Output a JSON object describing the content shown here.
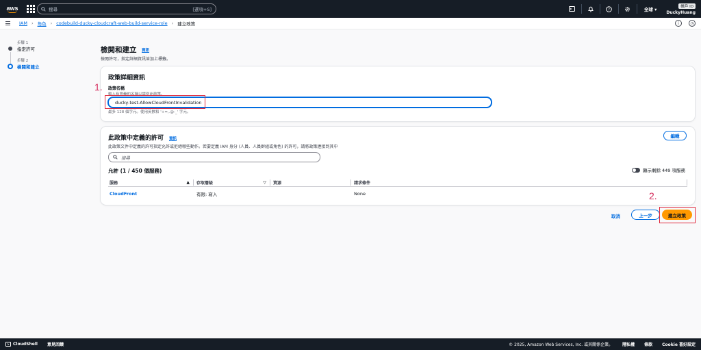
{
  "topnav": {
    "logo_text": "aws",
    "search_placeholder": "搜尋",
    "search_shortcut": "[選項+S]",
    "region": "全球",
    "account_id": "帳戶 ID",
    "username": "DuckyHuang"
  },
  "breadcrumb": {
    "items": [
      "IAM",
      "角色",
      "codebuild-ducky-cloudcraft-web-build-service-role"
    ],
    "current": "建立政策"
  },
  "steps": [
    {
      "number": "步驟 1",
      "label": "指定許可"
    },
    {
      "number": "步驟 2",
      "label": "檢閱和建立"
    }
  ],
  "page": {
    "title": "檢閱和建立",
    "info": "資訊",
    "description": "檢閱許可，指定詳細資訊並加上標籤。"
  },
  "policy_details": {
    "title": "政策詳細資訊",
    "name_label": "政策名稱",
    "name_description": "輸入有意義的名稱以識別此政策。",
    "name_value": "ducky-test-AllowCloudFrontInvalidation",
    "name_constraint": "最多 128 個字元。使用英數和 '+=,.@-_' 字元。"
  },
  "permissions": {
    "title": "此政策中定義的許可",
    "info": "資訊",
    "description": "此政策文件中定義的許可指定允許或拒絕哪些動作。若要定義 IAM 身分 (人員、人員群組或角色) 的許可，請將政策連接到其中",
    "edit_label": "編輯",
    "search_placeholder": "搜尋",
    "allow_title": "允許 (1 / 450 個服務)",
    "toggle_label": "顯示剩餘 449 項服務",
    "columns": [
      "服務",
      "存取層級",
      "資源",
      "請求條件"
    ],
    "rows": [
      {
        "service": "CloudFront",
        "access": "有限: 寫入",
        "resource": "",
        "condition": "None"
      }
    ]
  },
  "actions": {
    "cancel": "取消",
    "previous": "上一步",
    "create": "建立政策"
  },
  "annotations": {
    "one": "1.",
    "two": "2."
  },
  "footer": {
    "cloudshell": "CloudShell",
    "feedback": "意見回饋",
    "copyright": "© 2025, Amazon Web Services, Inc. 或其關係企業。",
    "privacy": "隱私權",
    "terms": "條款",
    "cookie": "Cookie 喜好設定"
  },
  "colors": {
    "nav_bg": "#161d26",
    "link": "#006ce0",
    "primary_button": "#ff9900",
    "annotation": "#e0283c"
  }
}
